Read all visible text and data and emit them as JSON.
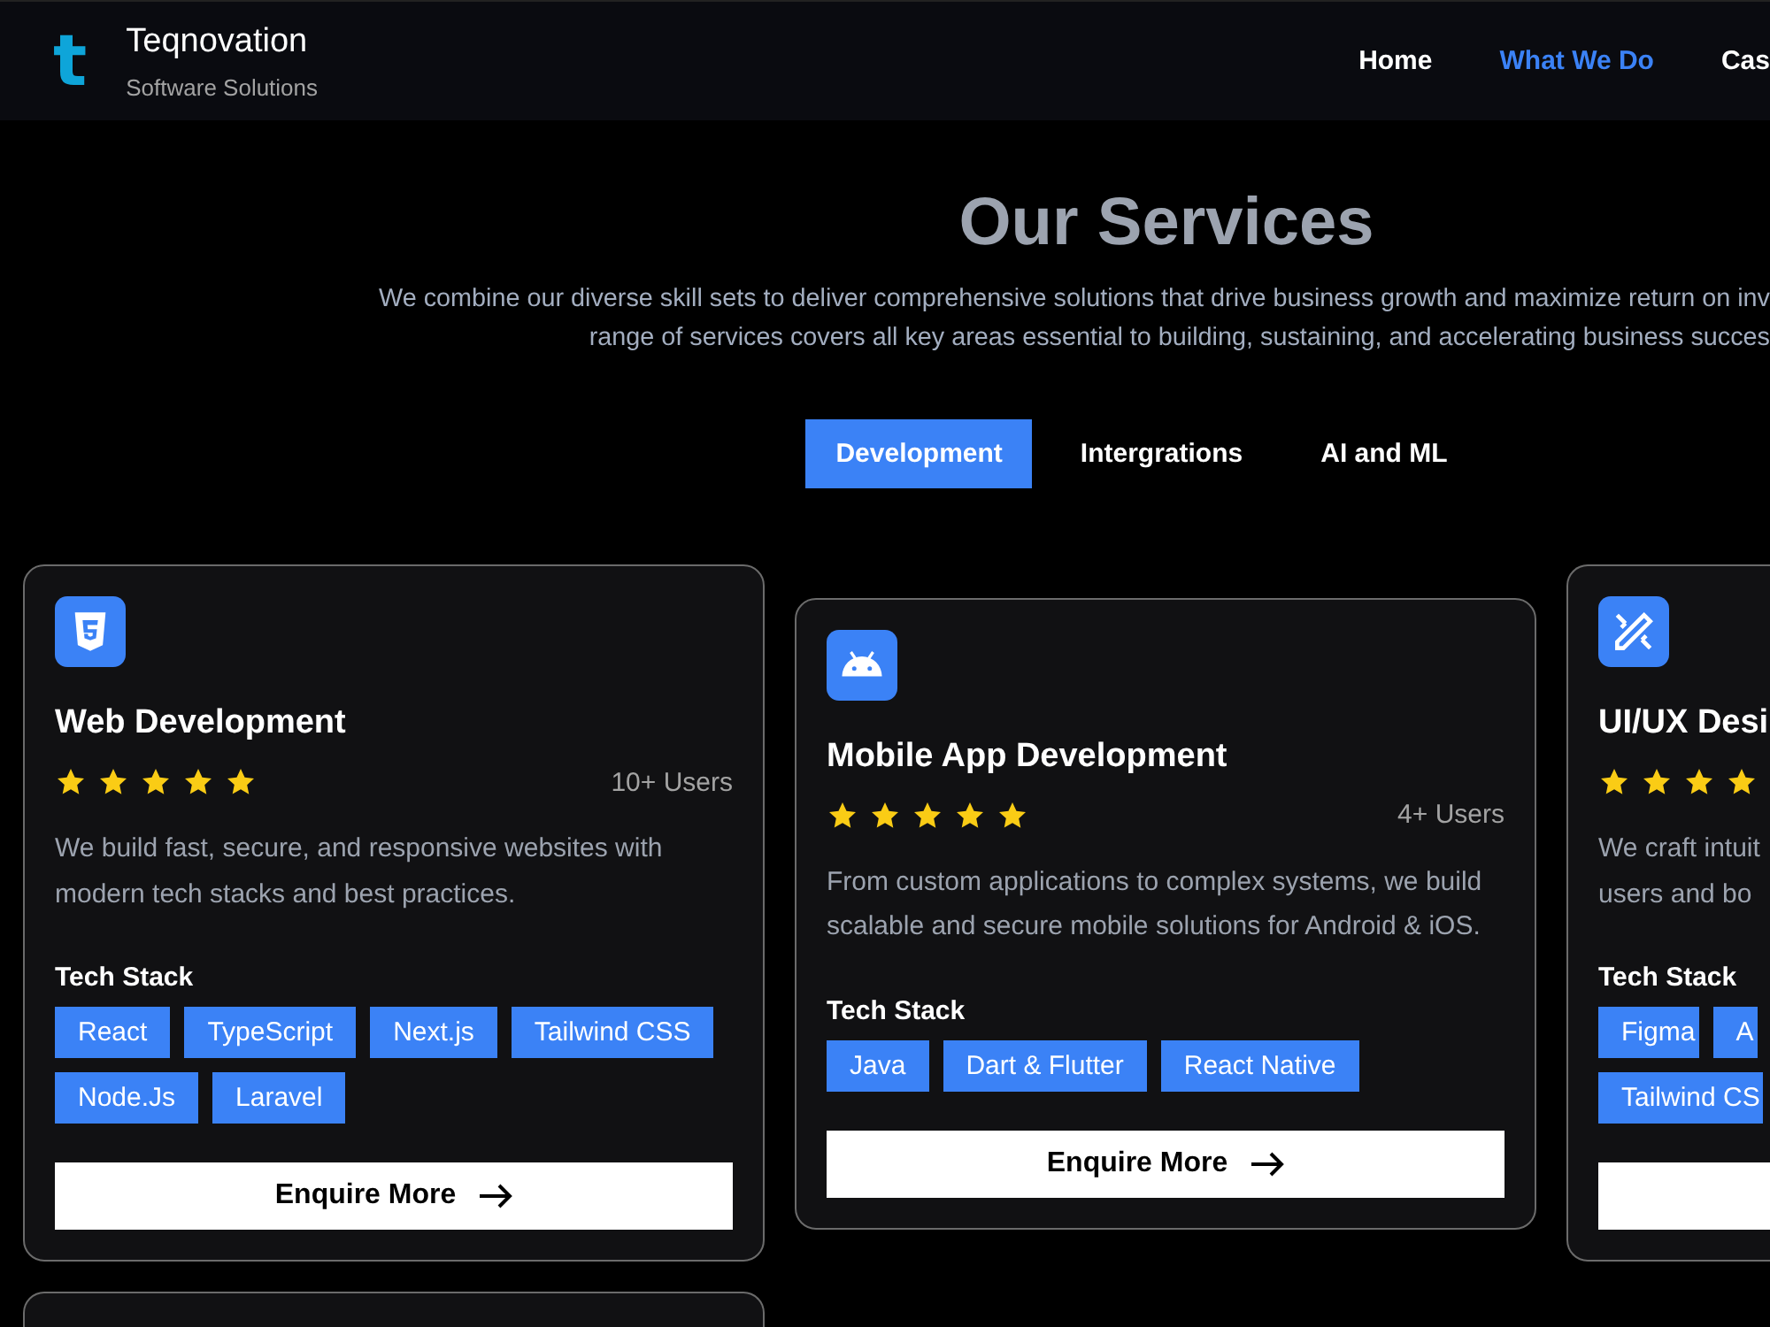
{
  "header": {
    "brand": "Teqnovation",
    "tagline": "Software Solutions",
    "logo_letter": "t"
  },
  "nav": [
    {
      "label": "Home",
      "selected": false
    },
    {
      "label": "What We Do",
      "selected": true
    },
    {
      "label": "Cas",
      "selected": false
    }
  ],
  "section": {
    "title": "Our Services",
    "subtitle": [
      "We combine our diverse skill sets to deliver comprehensive solutions that drive business growth and maximize return on inv",
      "range of services covers all key areas essential to building, sustaining, and accelerating business succes"
    ]
  },
  "tabs": [
    {
      "label": "Development",
      "selected": true
    },
    {
      "label": "Intergrations",
      "selected": false
    },
    {
      "label": "AI and ML",
      "selected": false
    }
  ],
  "cards": [
    {
      "kind": "service",
      "title": "Web Development",
      "stars": 5,
      "users": "10+ Users",
      "description": "We build fast, secure, and responsive websites with modern tech stacks and best practices.",
      "stack_label": "Tech Stack",
      "stack": [
        "React",
        "TypeScript",
        "Next.js",
        "Tailwind CSS",
        "Node.Js",
        "Laravel"
      ],
      "button": "Enquire More"
    },
    {
      "kind": "service",
      "title": "Mobile App Development",
      "stars": 5,
      "users": "4+ Users",
      "description": "From custom applications to complex systems, we build scalable and secure mobile solutions for Android & iOS.",
      "stack_label": "Tech Stack",
      "stack": [
        "Java",
        "Dart & Flutter",
        "React Native"
      ],
      "button": "Enquire More"
    },
    {
      "kind": "cut",
      "title": "UI/UX Desi",
      "stars": 4,
      "description_lines": [
        "We craft intuit",
        "users and bo"
      ],
      "stack_label": "Tech Stack",
      "stack": [
        "Figma",
        "A",
        "Tailwind CS"
      ]
    },
    {
      "kind": "partial"
    }
  ]
}
